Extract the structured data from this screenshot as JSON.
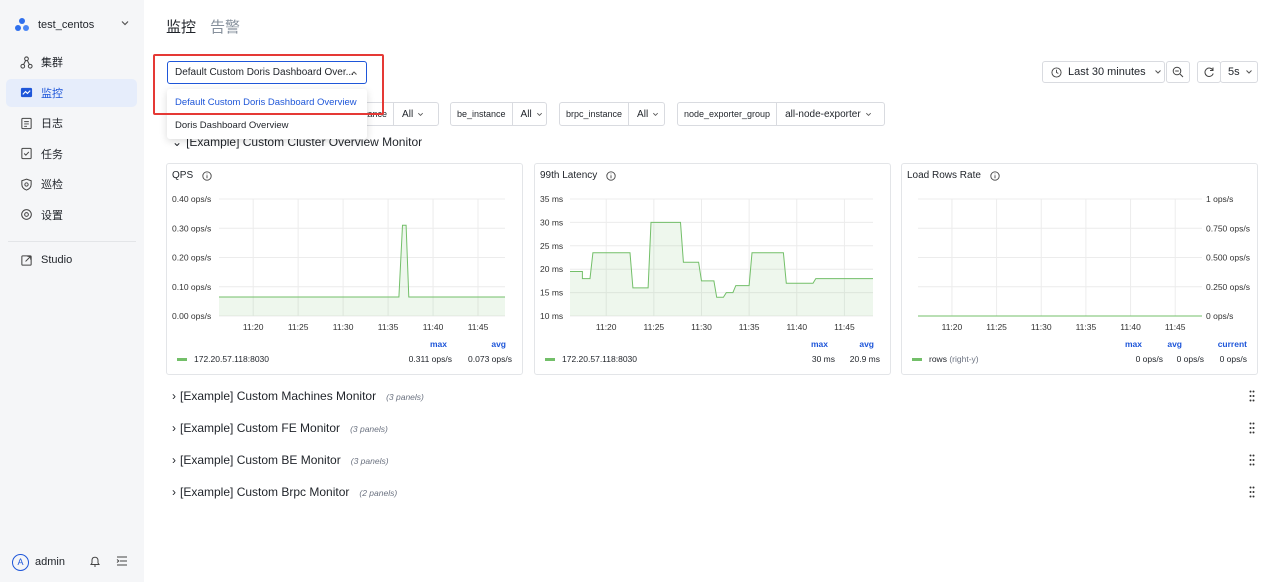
{
  "sidebar": {
    "cluster_name": "test_centos",
    "items": [
      {
        "label": "集群",
        "icon": "cluster-icon",
        "active": false
      },
      {
        "label": "监控",
        "icon": "monitor-icon",
        "active": true
      },
      {
        "label": "日志",
        "icon": "log-icon",
        "active": false
      },
      {
        "label": "任务",
        "icon": "task-icon",
        "active": false
      },
      {
        "label": "巡检",
        "icon": "inspection-icon",
        "active": false
      },
      {
        "label": "设置",
        "icon": "settings-icon",
        "active": false
      }
    ],
    "studio": "Studio",
    "user": {
      "initial": "A",
      "name": "admin"
    }
  },
  "header": {
    "tabs": [
      "监控",
      "告警"
    ]
  },
  "dashboard_select": {
    "value": "Default Custom Doris Dashboard Over...",
    "options": [
      "Default Custom Doris Dashboard Overview",
      "Doris Dashboard Overview"
    ],
    "selected_index": 0
  },
  "filters": [
    {
      "label": "fe_instance",
      "value": "All"
    },
    {
      "label": "be_instance",
      "value": "All"
    },
    {
      "label": "brpc_instance",
      "value": "All"
    },
    {
      "label": "node_exporter_group",
      "value": "all-node-exporter"
    }
  ],
  "time_controls": {
    "range": "Last 30 minutes",
    "refresh": "5s"
  },
  "rows": [
    {
      "title": "[Example] Custom Cluster Overview Monitor",
      "expanded": true,
      "panels_note": ""
    },
    {
      "title": "[Example] Custom Machines Monitor",
      "expanded": false,
      "panels_note": "(3 panels)"
    },
    {
      "title": "[Example] Custom FE Monitor",
      "expanded": false,
      "panels_note": "(3 panels)"
    },
    {
      "title": "[Example] Custom BE Monitor",
      "expanded": false,
      "panels_note": "(3 panels)"
    },
    {
      "title": "[Example] Custom Brpc Monitor",
      "expanded": false,
      "panels_note": "(2 panels)"
    }
  ],
  "chart_data": [
    {
      "type": "line",
      "title": "QPS",
      "x": [
        "11:20",
        "11:25",
        "11:30",
        "11:35",
        "11:40",
        "11:45"
      ],
      "y_ticks": [
        "0.40 ops/s",
        "0.30 ops/s",
        "0.20 ops/s",
        "0.10 ops/s",
        "0.00 ops/s"
      ],
      "ylim": [
        0,
        0.4
      ],
      "xlim_minutes": [
        16.2,
        48.0
      ],
      "series": [
        {
          "name": "172.20.57.118:8030",
          "color": "#73bf69",
          "points": [
            [
              16.2,
              0.065
            ],
            [
              22.6,
              0.065
            ],
            [
              24.0,
              0.065
            ],
            [
              32.0,
              0.065
            ],
            [
              36.2,
              0.065
            ],
            [
              36.6,
              0.31
            ],
            [
              37.0,
              0.31
            ],
            [
              37.3,
              0.065
            ],
            [
              44.0,
              0.065
            ],
            [
              48.0,
              0.065
            ]
          ],
          "stats": {
            "max": "0.311 ops/s",
            "avg": "0.073 ops/s"
          }
        }
      ],
      "legend_headers": [
        "max",
        "avg"
      ]
    },
    {
      "type": "line",
      "title": "99th Latency",
      "x": [
        "11:20",
        "11:25",
        "11:30",
        "11:35",
        "11:40",
        "11:45"
      ],
      "y_ticks": [
        "35 ms",
        "30 ms",
        "25 ms",
        "20 ms",
        "15 ms",
        "10 ms"
      ],
      "ylim": [
        10,
        35
      ],
      "xlim_minutes": [
        16.2,
        48.0
      ],
      "series": [
        {
          "name": "172.20.57.118:8030",
          "color": "#73bf69",
          "points": [
            [
              16.2,
              19.5
            ],
            [
              17.5,
              19.5
            ],
            [
              17.5,
              18
            ],
            [
              18.3,
              18
            ],
            [
              18.6,
              23.5
            ],
            [
              22.5,
              23.5
            ],
            [
              22.8,
              16
            ],
            [
              24.4,
              16
            ],
            [
              24.7,
              30
            ],
            [
              27.8,
              30
            ],
            [
              28.1,
              21.5
            ],
            [
              29.7,
              21.5
            ],
            [
              30.0,
              17.5
            ],
            [
              31.3,
              17.5
            ],
            [
              31.6,
              14
            ],
            [
              32.3,
              14
            ],
            [
              32.6,
              15
            ],
            [
              33.3,
              15
            ],
            [
              33.6,
              16.5
            ],
            [
              35.0,
              16.5
            ],
            [
              35.3,
              23.5
            ],
            [
              38.6,
              23.5
            ],
            [
              38.9,
              17
            ],
            [
              41.7,
              17
            ],
            [
              42.0,
              18
            ],
            [
              43.0,
              18
            ],
            [
              48.0,
              18
            ]
          ],
          "stats": {
            "max": "30 ms",
            "avg": "20.9 ms"
          }
        }
      ],
      "legend_headers": [
        "max",
        "avg"
      ]
    },
    {
      "type": "line",
      "title": "Load Rows Rate",
      "x": [
        "11:20",
        "11:25",
        "11:30",
        "11:35",
        "11:40",
        "11:45"
      ],
      "y_ticks": [
        "1 ops/s",
        "0.750 ops/s",
        "0.500 ops/s",
        "0.250 ops/s",
        "0 ops/s"
      ],
      "ylim": [
        0,
        1
      ],
      "xlim_minutes": [
        16.2,
        48.0
      ],
      "series": [
        {
          "name": "rows",
          "axis": "(right-y)",
          "color": "#73bf69",
          "points": [
            [
              16.2,
              0
            ],
            [
              48.0,
              0
            ]
          ],
          "stats": {
            "max": "0 ops/s",
            "avg": "0 ops/s",
            "current": "0 ops/s"
          }
        }
      ],
      "legend_headers": [
        "max",
        "avg",
        "current"
      ]
    }
  ]
}
